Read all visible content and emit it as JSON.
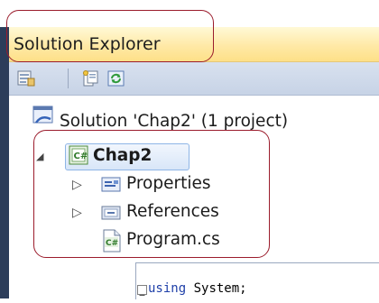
{
  "panel": {
    "title": "Solution Explorer"
  },
  "toolbar": {
    "buttons": [
      {
        "icon": "properties-icon"
      },
      {
        "icon": "show-all-files-icon"
      },
      {
        "icon": "refresh-icon"
      }
    ]
  },
  "tree": {
    "solution": {
      "label": "Solution 'Chap2' (1 project)",
      "icon": "solution-icon"
    },
    "project": {
      "label": "Chap2",
      "icon": "csharp-project-icon",
      "expanded": true,
      "selected": true
    },
    "children": [
      {
        "label": "Properties",
        "icon": "properties-folder-icon",
        "expandable": true
      },
      {
        "label": "References",
        "icon": "references-icon",
        "expandable": true
      },
      {
        "label": "Program.cs",
        "icon": "csharp-file-icon",
        "expandable": false
      }
    ],
    "expander_collapsed": "▷",
    "expander_expanded": "◢"
  },
  "editor": {
    "keyword": "using",
    "rest": " System;"
  },
  "colors": {
    "title_gradient": "#ffe9a6",
    "annotation": "#9b1c2c",
    "selection_border": "#8eb5e6",
    "keyword": "#1e3fa8"
  }
}
